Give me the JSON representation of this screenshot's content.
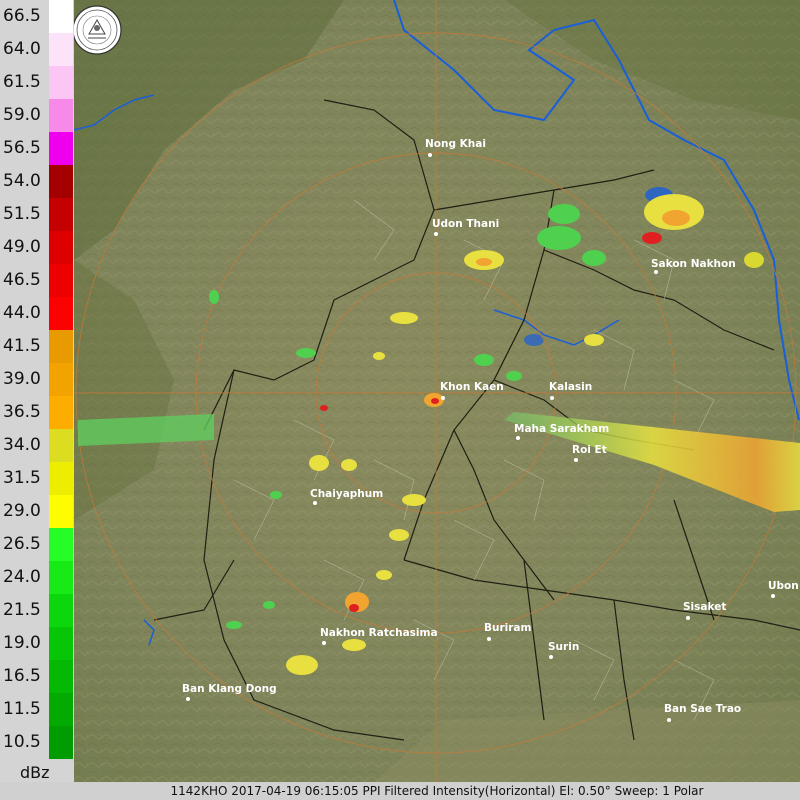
{
  "legend": {
    "unit": "dBz",
    "levels": [
      {
        "label": "66.5",
        "color": "#ffffff"
      },
      {
        "label": "64.0",
        "color": "#fde3fa"
      },
      {
        "label": "61.5",
        "color": "#fbc6f4"
      },
      {
        "label": "59.0",
        "color": "#f78ae8"
      },
      {
        "label": "56.5",
        "color": "#ee00ee"
      },
      {
        "label": "54.0",
        "color": "#a40000"
      },
      {
        "label": "51.5",
        "color": "#c50000"
      },
      {
        "label": "49.0",
        "color": "#dc0000"
      },
      {
        "label": "46.5",
        "color": "#ed0000"
      },
      {
        "label": "44.0",
        "color": "#fd0000"
      },
      {
        "label": "41.5",
        "color": "#e79b00"
      },
      {
        "label": "39.0",
        "color": "#f3a300"
      },
      {
        "label": "36.5",
        "color": "#fdac00"
      },
      {
        "label": "34.0",
        "color": "#dcdc20"
      },
      {
        "label": "31.5",
        "color": "#eded00"
      },
      {
        "label": "29.0",
        "color": "#fdfd00"
      },
      {
        "label": "26.5",
        "color": "#26fd26"
      },
      {
        "label": "24.0",
        "color": "#17ea17"
      },
      {
        "label": "21.5",
        "color": "#0cd60c"
      },
      {
        "label": "19.0",
        "color": "#07c607"
      },
      {
        "label": "16.5",
        "color": "#04b804"
      },
      {
        "label": "11.5",
        "color": "#02aa02"
      },
      {
        "label": "10.5",
        "color": "#019c01"
      }
    ]
  },
  "map": {
    "cities": [
      {
        "name": "Nong Khai"
      },
      {
        "name": "Udon Thani"
      },
      {
        "name": "Sakon Nakhon"
      },
      {
        "name": "Khon Kaen"
      },
      {
        "name": "Kalasin"
      },
      {
        "name": "Maha Sarakham"
      },
      {
        "name": "Roi Et"
      },
      {
        "name": "Chaiyaphum"
      },
      {
        "name": "Ubon"
      },
      {
        "name": "Sisaket"
      },
      {
        "name": "Buriram"
      },
      {
        "name": "Surin"
      },
      {
        "name": "Nakhon Ratchasima"
      },
      {
        "name": "Ban Klang Dong"
      },
      {
        "name": "Ban Sae Trao"
      }
    ],
    "seal_icon": "radar-agency-seal-icon"
  },
  "status_bar": {
    "text": "1142KHO 2017-04-19 06:15:05 PPI Filtered Intensity(Horizontal)  El: 0.50°  Sweep: 1 Polar"
  }
}
